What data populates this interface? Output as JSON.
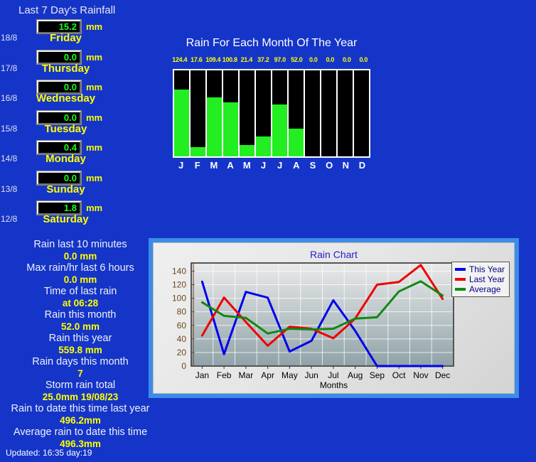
{
  "background_color": "#1535c8",
  "days_panel": {
    "title": "Last 7 Day's Rainfall",
    "unit": "mm",
    "days": [
      {
        "date": "18/8",
        "value": "15.2",
        "name": "Friday"
      },
      {
        "date": "17/8",
        "value": "0.0",
        "name": "Thursday"
      },
      {
        "date": "16/8",
        "value": "0.0",
        "name": "Wednesday"
      },
      {
        "date": "15/8",
        "value": "0.0",
        "name": "Tuesday"
      },
      {
        "date": "14/8",
        "value": "0.4",
        "name": "Monday"
      },
      {
        "date": "13/8",
        "value": "0.0",
        "name": "Sunday"
      },
      {
        "date": "12/8",
        "value": "1.8",
        "name": "Saturday"
      }
    ]
  },
  "stats": [
    {
      "label": "Rain last 10 minutes",
      "value": "0.0 mm"
    },
    {
      "label": "Max rain/hr last 6 hours",
      "value": "0.0 mm"
    },
    {
      "label": "Time of last rain",
      "value": "at 06:28"
    },
    {
      "label": "Rain this month",
      "value": "52.0 mm"
    },
    {
      "label": "Rain this year",
      "value": "559.8 mm"
    },
    {
      "label": "Rain days this month",
      "value": "7"
    },
    {
      "label": "Storm rain total",
      "value": "25.0mm 19/08/23"
    },
    {
      "label": "Rain to date this time last year",
      "value": "496.2mm"
    },
    {
      "label": "Average rain to date this time",
      "value": "496.3mm"
    }
  ],
  "updated": "Updated:  16:35 day:19",
  "chart_data": [
    {
      "type": "bar",
      "title": "Rain For Each Month Of The Year",
      "categories": [
        "J",
        "F",
        "M",
        "A",
        "M",
        "J",
        "J",
        "A",
        "S",
        "O",
        "N",
        "D"
      ],
      "values": [
        124.4,
        17.6,
        109.4,
        100.8,
        21.4,
        37.2,
        97.0,
        52.0,
        0.0,
        0.0,
        0.0,
        0.0
      ],
      "value_labels": [
        "124.4",
        "17.6",
        "109.4",
        "100.8",
        "21.4",
        "37.2",
        "97.0",
        "52.0",
        "0.0",
        "0.0",
        "0.0",
        "0.0"
      ],
      "xlabel": "",
      "ylabel": "",
      "ylim": [
        0,
        160
      ],
      "bar_color": "#22ee22",
      "plot_background": "#000000",
      "grid": false
    },
    {
      "type": "line",
      "title": "Rain Chart",
      "xlabel": "Months",
      "ylabel": "",
      "categories": [
        "Jan",
        "Feb",
        "Mar",
        "Apr",
        "May",
        "Jun",
        "Jul",
        "Aug",
        "Sep",
        "Oct",
        "Nov",
        "Dec"
      ],
      "yticks": [
        0,
        20,
        40,
        60,
        80,
        100,
        120,
        140
      ],
      "ylim": [
        0,
        152
      ],
      "grid": true,
      "legend_position": "right",
      "series": [
        {
          "name": "This Year",
          "color": "#0000ee",
          "values": [
            124.4,
            17.6,
            109.4,
            100.8,
            21.4,
            37.2,
            97.0,
            52.0,
            0.0,
            0.0,
            0.0,
            0.0
          ]
        },
        {
          "name": "Last Year",
          "color": "#ee0000",
          "values": [
            45.0,
            101.0,
            65.0,
            30.0,
            58.0,
            55.0,
            41.0,
            70.0,
            120.0,
            124.0,
            149.0,
            99.0
          ]
        },
        {
          "name": "Average",
          "color": "#118811",
          "values": [
            94.0,
            74.0,
            71.0,
            48.0,
            55.0,
            54.0,
            55.0,
            70.0,
            72.0,
            110.0,
            125.0,
            104.0
          ]
        }
      ]
    }
  ]
}
